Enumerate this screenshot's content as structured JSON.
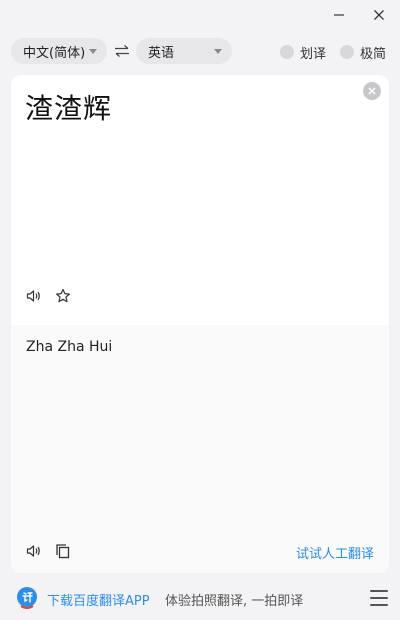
{
  "window": {
    "minimize_icon": "minimize-icon",
    "close_icon": "close-icon"
  },
  "toolbar": {
    "source_language": "中文(简体)",
    "target_language": "英语",
    "swap_icon": "swap-arrows-icon",
    "toggles": [
      {
        "label": "划译",
        "on": false
      },
      {
        "label": "极简",
        "on": false
      }
    ]
  },
  "source": {
    "text": "渣渣辉",
    "actions": [
      "speaker-icon",
      "star-icon",
      "clear-icon"
    ]
  },
  "result": {
    "text": "Zha Zha Hui",
    "actions": [
      "speaker-icon",
      "copy-icon"
    ],
    "human_translate_link": "试试人工翻译"
  },
  "footer": {
    "download_link": "下载百度翻译APP",
    "promo_text": "体验拍照翻译, 一拍即译",
    "menu_icon": "hamburger-menu-icon"
  },
  "colors": {
    "accent": "#2b8ee8",
    "background": "#f3f3f5",
    "card": "#ffffff",
    "result_bg": "#fafafa"
  }
}
